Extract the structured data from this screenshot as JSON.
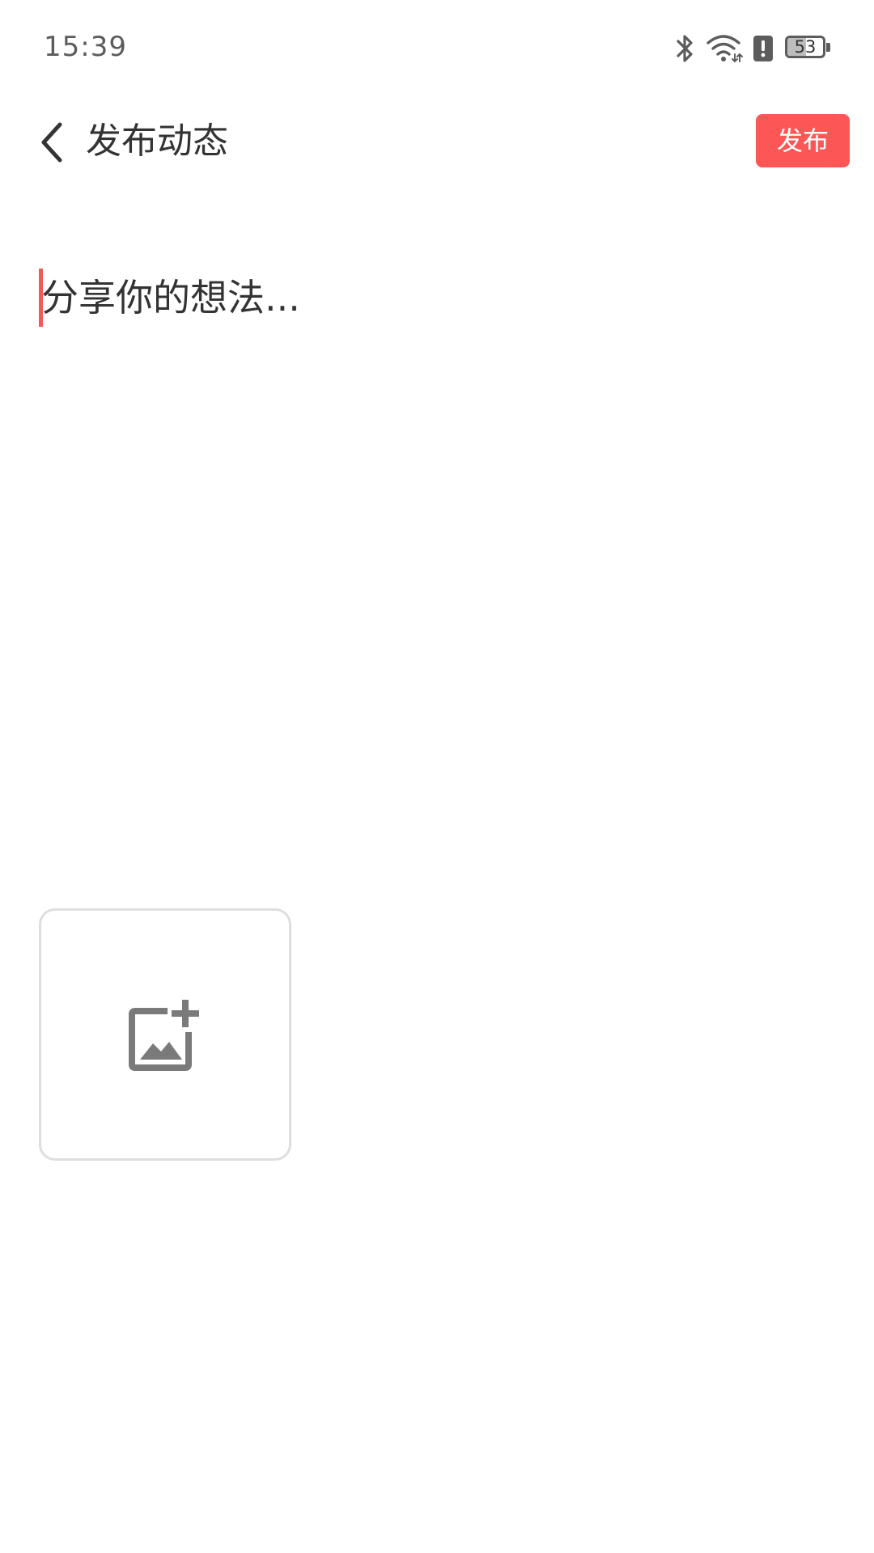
{
  "status_bar": {
    "time": "15:39",
    "icons": [
      "bluetooth-icon",
      "wifi-icon",
      "alert-icon",
      "battery-icon"
    ],
    "battery_level": "53"
  },
  "header": {
    "back_icon": "chevron-left-icon",
    "title": "发布动态",
    "publish_label": "发布"
  },
  "composer": {
    "value": "",
    "placeholder": "分享你的想法..."
  },
  "media": {
    "add_image_icon": "add-photo-icon"
  },
  "colors": {
    "accent": "#fd5656",
    "cursor": "#f25a55",
    "text_primary": "#333333",
    "icon_gray": "#7a7a7a",
    "tile_border": "#dedede",
    "background": "#ffffff"
  }
}
